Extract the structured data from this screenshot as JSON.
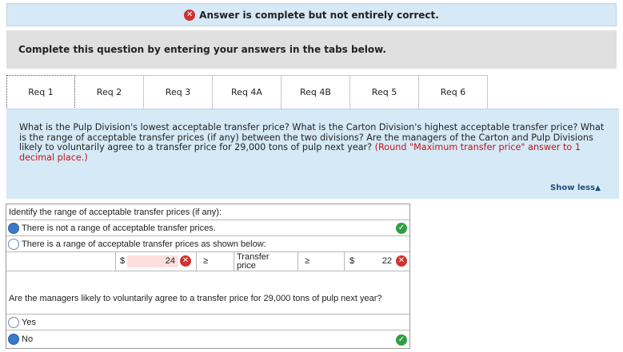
{
  "banner": {
    "status_icon": "x-circle-icon",
    "text": "Answer is complete but not entirely correct."
  },
  "instructions": "Complete this question by entering your answers in the tabs below.",
  "tabs": [
    {
      "label": "Req 1",
      "active": true
    },
    {
      "label": "Req 2",
      "active": false
    },
    {
      "label": "Req 3",
      "active": false
    },
    {
      "label": "Req 4A",
      "active": false
    },
    {
      "label": "Req 4B",
      "active": false
    },
    {
      "label": "Req 5",
      "active": false
    },
    {
      "label": "Req 6",
      "active": false
    }
  ],
  "question": {
    "text": "What is the Pulp Division's lowest acceptable transfer price? What is the Carton Division's highest acceptable transfer price? What is the range of acceptable transfer prices (if any) between the two divisions? Are the managers of the Carton and Pulp Divisions likely to voluntarily agree to a transfer price for 29,000 tons of pulp next year?",
    "rounding_note": "(Round \"Maximum transfer price\" answer to 1 decimal place.)"
  },
  "show_less": "Show less",
  "answer": {
    "range_prompt": "Identify the range of acceptable transfer prices (if any):",
    "option_no_range": "There is not a range of acceptable transfer prices.",
    "option_range": "There is a range of acceptable transfer prices as shown below:",
    "currency_left": "$",
    "min_value": "24",
    "ge_left": "≥",
    "middle_label": "Transfer price",
    "ge_right": "≥",
    "currency_right": "$",
    "max_value": "22",
    "agree_prompt": "Are the managers likely to voluntarily agree to a transfer price for 29,000 tons of pulp next year?",
    "option_yes": "Yes",
    "option_no": "No",
    "colors": {
      "correct": "#2f9e44",
      "incorrect": "#d0312d",
      "selected_radio": "#3c78c8"
    }
  }
}
